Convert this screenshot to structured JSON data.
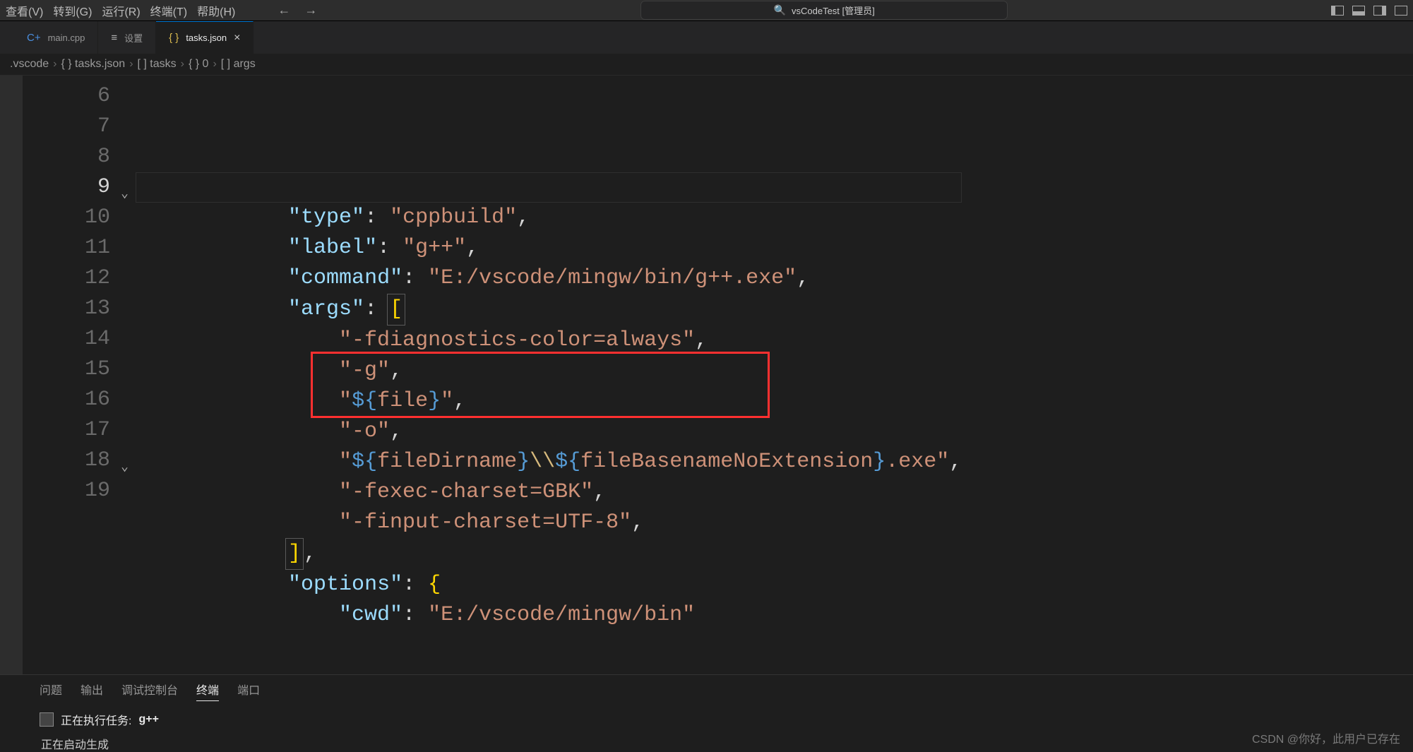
{
  "menu": {
    "items": [
      "查看(V)",
      "转到(G)",
      "运行(R)",
      "终端(T)",
      "帮助(H)"
    ]
  },
  "navigation": {
    "back": "←",
    "forward": "→"
  },
  "search": {
    "icon": "🔍",
    "text": "vsCodeTest [管理员]"
  },
  "tabs": [
    {
      "icon": "C+",
      "label": "main.cpp",
      "active": false,
      "close": false
    },
    {
      "icon": "≡",
      "label": "设置",
      "active": false,
      "close": false
    },
    {
      "icon": "{ }",
      "label": "tasks.json",
      "active": true,
      "close": true
    }
  ],
  "breadcrumb": {
    "items": [
      ".vscode",
      "{ } tasks.json",
      "[ ] tasks",
      "{ } 0",
      "[ ] args"
    ]
  },
  "line_numbers": [
    "6",
    "7",
    "8",
    "9",
    "10",
    "11",
    "12",
    "13",
    "14",
    "15",
    "16",
    "17",
    "18",
    "19"
  ],
  "current_line_index": 3,
  "foldable_lines": [
    3,
    12
  ],
  "code": {
    "indent1": "            ",
    "indent2": "                ",
    "indent3": "            ",
    "lines": [
      {
        "k": "type",
        "v": "cppbuild"
      },
      {
        "k": "label",
        "v": "g++"
      },
      {
        "k": "command",
        "v": "E:/vscode/mingw/bin/g++.exe"
      }
    ],
    "args_key": "args",
    "args": [
      "-fdiagnostics-color=always",
      "-g",
      "${file}",
      "-o",
      "${fileDirname}\\\\${fileBasenameNoExtension}.exe",
      "-fexec-charset=GBK",
      "-finput-charset=UTF-8"
    ],
    "options_key": "options",
    "cwd_key": "cwd",
    "cwd_value": "E:/vscode/mingw/bin"
  },
  "panel": {
    "tabs": [
      "问题",
      "输出",
      "调试控制台",
      "终端",
      "端口"
    ],
    "active_tab": 3,
    "task_label": "正在执行任务:",
    "task_name": "g++",
    "status_line": "正在启动生成"
  },
  "watermark": "CSDN @你好，此用户已存在"
}
